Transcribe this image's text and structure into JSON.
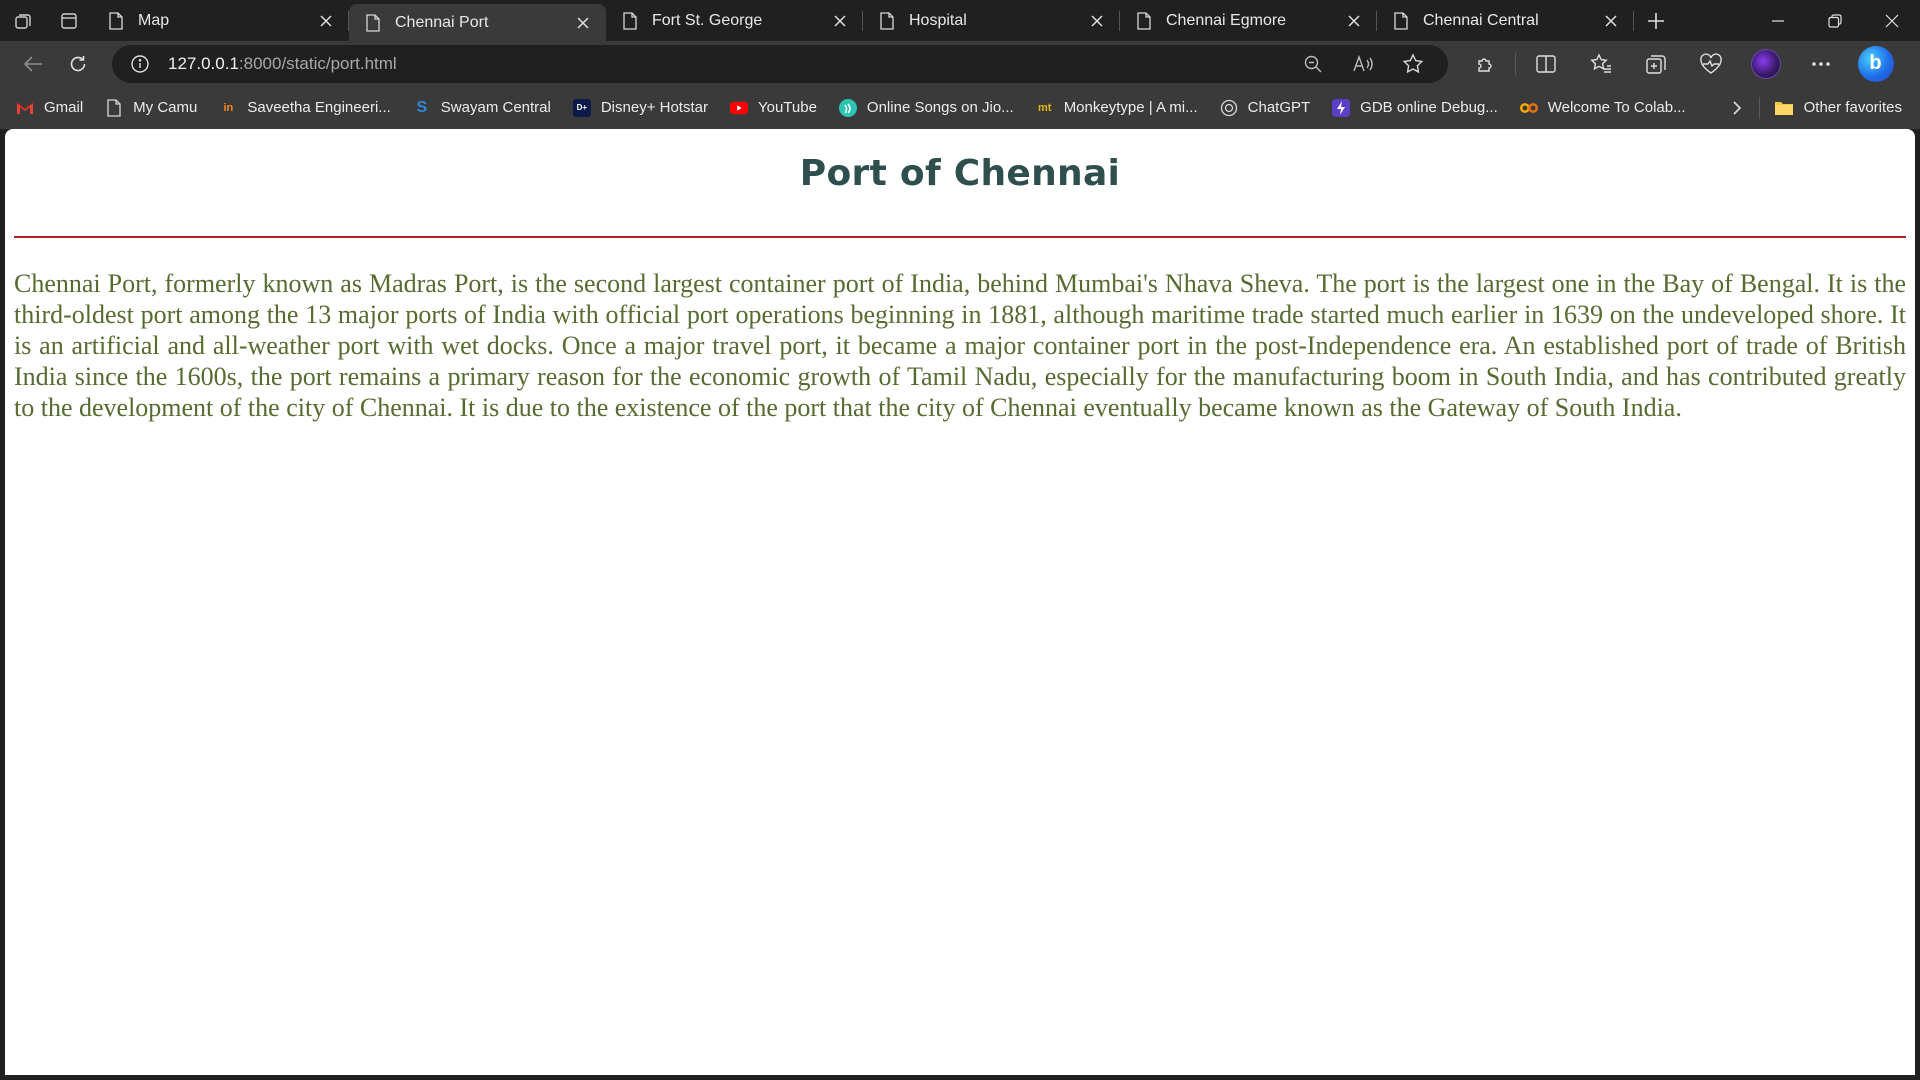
{
  "tabs": [
    {
      "title": "Map",
      "active": false
    },
    {
      "title": "Chennai Port",
      "active": true
    },
    {
      "title": "Fort St. George",
      "active": false
    },
    {
      "title": "Hospital",
      "active": false
    },
    {
      "title": "Chennai Egmore",
      "active": false
    },
    {
      "title": "Chennai Central",
      "active": false
    }
  ],
  "address": {
    "host": "127.0.0.1",
    "path": ":8000/static/port.html"
  },
  "bookmarks": [
    {
      "label": "Gmail",
      "icon": "gmail-icon"
    },
    {
      "label": "My Camu",
      "icon": "page-icon"
    },
    {
      "label": "Saveetha Engineeri...",
      "icon": "saveetha-icon"
    },
    {
      "label": "Swayam Central",
      "icon": "swayam-icon"
    },
    {
      "label": "Disney+ Hotstar",
      "icon": "hotstar-icon"
    },
    {
      "label": "YouTube",
      "icon": "youtube-icon"
    },
    {
      "label": "Online Songs on Jio...",
      "icon": "jiosaavn-icon"
    },
    {
      "label": "Monkeytype | A mi...",
      "icon": "monkeytype-icon"
    },
    {
      "label": "ChatGPT",
      "icon": "chatgpt-icon"
    },
    {
      "label": "GDB online Debug...",
      "icon": "gdb-icon"
    },
    {
      "label": "Welcome To Colab...",
      "icon": "colab-icon"
    }
  ],
  "other_favorites": "Other favorites",
  "page": {
    "heading": "Port of Chennai",
    "paragraph": "Chennai Port, formerly known as Madras Port, is the second largest container port of India, behind Mumbai's Nhava Sheva. The port is the largest one in the Bay of Bengal. It is the third-oldest port among the 13 major ports of India with official port operations beginning in 1881, although maritime trade started much earlier in 1639 on the undeveloped shore. It is an artificial and all-weather port with wet docks. Once a major travel port, it became a major container port in the post-Independence era. An established port of trade of British India since the 1600s, the port remains a primary reason for the economic growth of Tamil Nadu, especially for the manufacturing boom in South India, and has contributed greatly to the development of the city of Chennai. It is due to the existence of the port that the city of Chennai eventually became known as the Gateway of South India."
  },
  "colors": {
    "heading": "#2f4f4f",
    "rule": "#b22222",
    "paragraph": "#556b2f"
  }
}
